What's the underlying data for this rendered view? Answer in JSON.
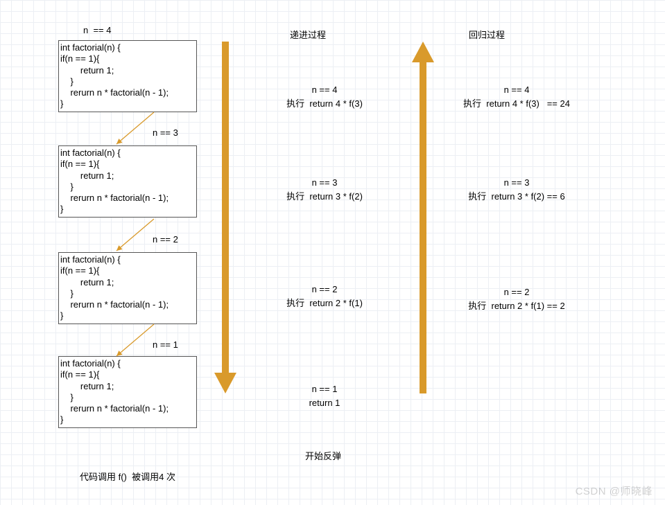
{
  "top": {
    "n4": "n  == 4",
    "forward_title": "递进过程",
    "back_title": "回归过程"
  },
  "code": {
    "block": "int factorial(n) {\nif(n == 1){\n        return 1;\n    }\n    rerurn n * factorial(n - 1);\n}"
  },
  "between": {
    "n3": "n == 3",
    "n2": "n == 2",
    "n1": "n == 1"
  },
  "forward": {
    "s4": "n == 4\n执行  return 4 * f(3)",
    "s3": "n == 3\n执行  return 3 * f(2)",
    "s2": "n == 2\n执行  return 2 * f(1)",
    "s1": "n == 1\nreturn 1",
    "rebound": "开始反弹"
  },
  "back": {
    "s4": "n == 4\n执行  return 4 * f(3)   == 24",
    "s3": "n == 3\n执行  return 3 * f(2) == 6",
    "s2": "n == 2\n执行  return 2 * f(1) == 2"
  },
  "bottom": {
    "caption": "代码调用 f()  被调用4 次"
  },
  "watermark": "CSDN @师晓峰"
}
